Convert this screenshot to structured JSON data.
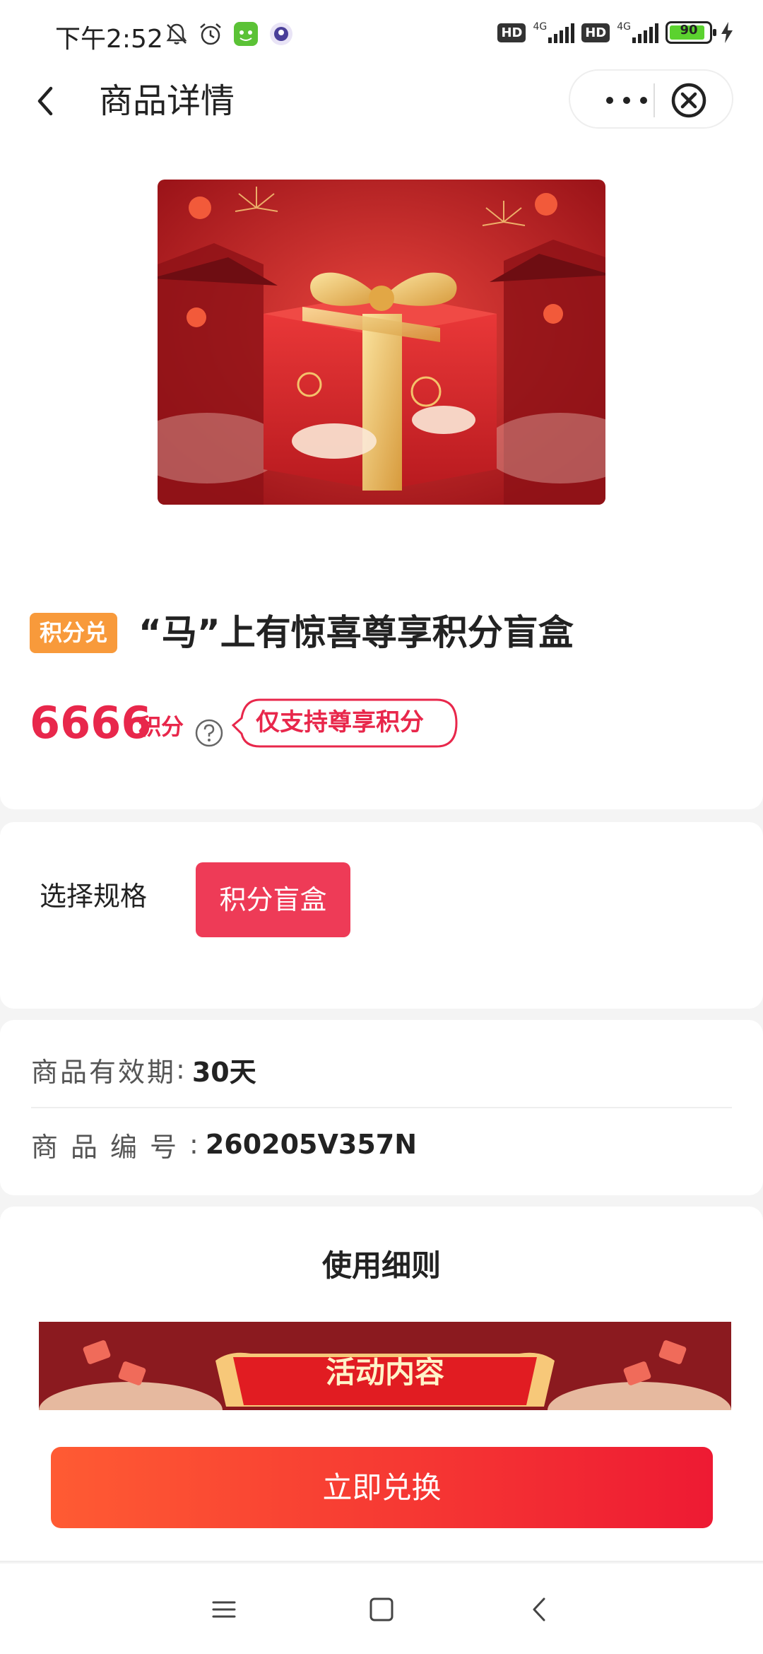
{
  "status_bar": {
    "time": "下午2:52",
    "icons": [
      "bell-off-icon",
      "alarm-icon",
      "app-notification-icon",
      "app-notification-icon-2"
    ],
    "hd_label": "HD",
    "network_label": "4G",
    "battery": "90",
    "battery_color": "#5bd22f"
  },
  "nav": {
    "title": "商品详情",
    "icons": [
      "back-arrow-icon",
      "more-dots-icon",
      "close-circle-icon"
    ]
  },
  "product": {
    "tag": "积分兑",
    "title": "“马”上有惊喜尊享积分盲盒",
    "price": "6666",
    "price_unit": "积分",
    "bubble_text": "仅支持尊享积分",
    "accent_color": "#e8274b"
  },
  "spec": {
    "label": "选择规格",
    "option": "积分盲盒"
  },
  "info": {
    "validity_label": "商品有效期",
    "validity_colon": ":",
    "validity_value": "30天",
    "code_label": "商品编号",
    "code_colon": ":",
    "code_value": "260205V357N"
  },
  "usage": {
    "title": "使用细则",
    "banner_text": "活动内容"
  },
  "cta": {
    "label": "立即兑换"
  }
}
